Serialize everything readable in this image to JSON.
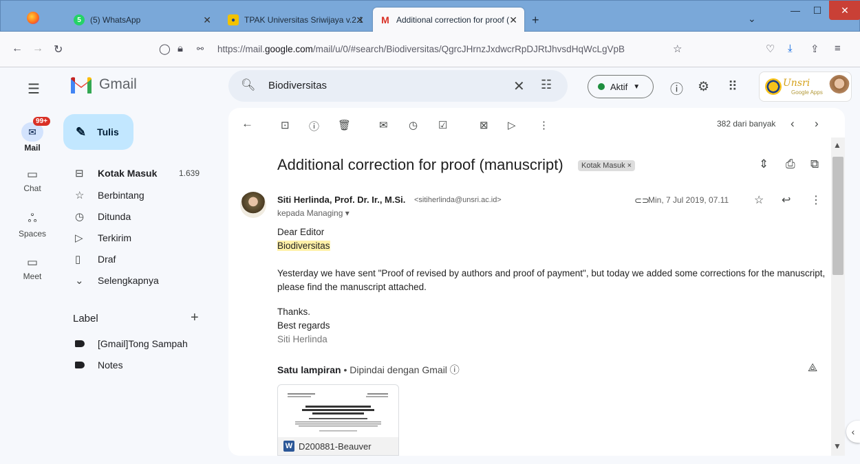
{
  "browser": {
    "tabs": [
      {
        "label": "(5) WhatsApp",
        "icon": "whatsapp-icon"
      },
      {
        "label": "TPAK Universitas Sriwijaya v.2.1",
        "icon": "tpak-icon"
      },
      {
        "label": "Additional correction for proof (",
        "icon": "gmail-icon"
      }
    ],
    "url_prefix": "https://mail.",
    "url_domain": "google.com",
    "url_rest": "/mail/u/0/#search/Biodiversitas/QgrcJHrnzJxdwcrRpDJRtJhvsdHqWcLgVpB"
  },
  "gmail": {
    "app_name": "Gmail",
    "search_value": "Biodiversitas",
    "status": "Aktif",
    "account_logo_text": "Unsri",
    "account_logo_sub": "Google Apps"
  },
  "rail": {
    "mail_label": "Mail",
    "mail_badge": "99+",
    "chat_label": "Chat",
    "spaces_label": "Spaces",
    "meet_label": "Meet"
  },
  "nav": {
    "compose_label": "Tulis",
    "items": [
      {
        "label": "Kotak Masuk",
        "count": "1.639"
      },
      {
        "label": "Berbintang"
      },
      {
        "label": "Ditunda"
      },
      {
        "label": "Terkirim"
      },
      {
        "label": "Draf"
      },
      {
        "label": "Selengkapnya"
      }
    ],
    "labels_heading": "Label",
    "labels": [
      {
        "label": "[Gmail]Tong Sampah"
      },
      {
        "label": "Notes"
      }
    ]
  },
  "thread": {
    "paging": "382 dari banyak",
    "subject": "Additional correction for proof (manuscript)",
    "label_chip": "Kotak Masuk ×",
    "sender_name": "Siti Herlinda, Prof. Dr. Ir., M.Si.",
    "sender_email": "<sitiherlinda@unsri.ac.id>",
    "to_line": "kepada Managing ▾",
    "date": "Min, 7 Jul 2019, 07.11",
    "body": {
      "greeting": "Dear Editor",
      "highlight": "Biodiversitas",
      "para1": "Yesterday we have sent \"Proof of revised by authors and proof of payment\", but today we added some corrections for the manuscript, please find the manuscript attached.",
      "thanks": "Thanks.",
      "regards": "Best regards",
      "signature": "Siti Herlinda"
    },
    "attachment_heading": "Satu lampiran",
    "attachment_sub": " • Dipindai dengan Gmail ⓘ",
    "attachment_name": "D200881-Beauver"
  }
}
